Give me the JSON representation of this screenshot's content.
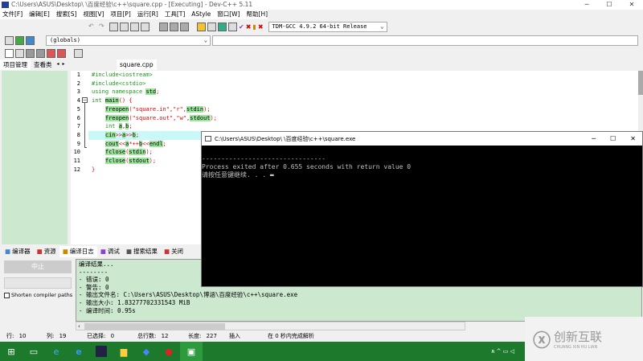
{
  "window": {
    "title": "C:\\Users\\ASUS\\Desktop\\        \\百度经验\\c++\\square.cpp - [Executing] - Dev-C++ 5.11",
    "min": "─",
    "max": "☐",
    "close": "✕"
  },
  "menu": [
    "文件[F]",
    "编辑[E]",
    "搜索[S]",
    "视图[V]",
    "项目[P]",
    "运行[R]",
    "工具[T]",
    "AStyle",
    "窗口[W]",
    "帮助[H]"
  ],
  "toolbar": {
    "compiler_select": "TDM-GCC 4.9.2 64-bit Release",
    "scope_select": "(globals)"
  },
  "left_tabs": [
    "项目管理",
    "查看类"
  ],
  "editor": {
    "file_tab": "square.cpp",
    "current_line": 10,
    "lines": [
      [
        [
          "t",
          "#include<iostream>",
          "grn"
        ]
      ],
      [
        [
          "t",
          "#include<cstdio>",
          "grn"
        ]
      ],
      [
        [
          "t",
          "using namespace ",
          "grn"
        ],
        [
          "t",
          "std",
          "hl"
        ],
        [
          "t",
          ";",
          "red"
        ]
      ],
      [
        [
          "t",
          "int ",
          "grn"
        ],
        [
          "t",
          "main",
          "hl"
        ],
        [
          "t",
          "() {",
          "red"
        ]
      ],
      [
        [
          "t",
          "    "
        ],
        [
          "t",
          "freopen",
          "hl"
        ],
        [
          "t",
          "(\"square.in\",\"r\",",
          "red"
        ],
        [
          "t",
          "stdin",
          "hl"
        ],
        [
          "t",
          ");",
          "red"
        ]
      ],
      [
        [
          "t",
          "    "
        ],
        [
          "t",
          "freopen",
          "hl"
        ],
        [
          "t",
          "(\"square.out\",\"w\",",
          "red"
        ],
        [
          "t",
          "stdout",
          "hl"
        ],
        [
          "t",
          ");",
          "red"
        ]
      ],
      [
        [
          "t",
          "    int ",
          "grn"
        ],
        [
          "t",
          "a",
          "hl"
        ],
        [
          "t",
          ",",
          "red"
        ],
        [
          "t",
          "b",
          "hl"
        ],
        [
          "t",
          ";",
          "red"
        ]
      ],
      [
        [
          "t",
          "    "
        ],
        [
          "t",
          "cin",
          "hl"
        ],
        [
          "t",
          ">>",
          "red"
        ],
        [
          "t",
          "a",
          "hl"
        ],
        [
          "t",
          ">>",
          "red"
        ],
        [
          "t",
          "b",
          "hl"
        ],
        [
          "t",
          ";",
          "red"
        ]
      ],
      [
        [
          "t",
          "    "
        ],
        [
          "t",
          "cout",
          "hl"
        ],
        [
          "t",
          "<<",
          "red"
        ],
        [
          "t",
          "a",
          "hl"
        ],
        [
          "t",
          "*++",
          "red"
        ],
        [
          "t",
          "b",
          "hl"
        ],
        [
          "t",
          "<<",
          "red"
        ],
        [
          "t",
          "endl",
          "hl"
        ],
        [
          "t",
          ";",
          "red"
        ]
      ],
      [
        [
          "t",
          "    "
        ],
        [
          "t",
          "fclose",
          "hl"
        ],
        [
          "t",
          "(",
          "red"
        ],
        [
          "t",
          "stdin",
          "hl"
        ],
        [
          "t",
          ");",
          "red"
        ]
      ],
      [
        [
          "t",
          "    "
        ],
        [
          "t",
          "fclose",
          "hl"
        ],
        [
          "t",
          "(",
          "red"
        ],
        [
          "t",
          "stdout",
          "hl"
        ],
        [
          "t",
          ");",
          "red"
        ]
      ],
      [
        [
          "t",
          "}",
          "red"
        ]
      ]
    ]
  },
  "console": {
    "title": "C:\\Users\\ASUS\\Desktop\\        \\百度经验\\c++\\square.exe",
    "lines": [
      "",
      "--------------------------------",
      "Process exited after 0.655 seconds with return value 0",
      "请按任意键继续. . . ▬"
    ]
  },
  "bottom_tabs": [
    "编译器",
    "资源",
    "编译日志",
    "调试",
    "搜索结果",
    "关闭"
  ],
  "abort_button": "中止",
  "shorten_paths": "Shorten compiler paths",
  "log": [
    "编译结果...",
    "--------",
    "- 错误: 0",
    "- 警告: 0",
    "- 输出文件名: C:\\Users\\ASUS\\Desktop\\博涵\\百度经验\\c++\\square.exe",
    "- 输出大小: 1.83277702331543 MiB",
    "- 编译时间: 0.95s"
  ],
  "status": {
    "row_label": "行:",
    "row": "10",
    "col_label": "列:",
    "col": "19",
    "sel_label": "已选择:",
    "sel": "0",
    "total_label": "总行数:",
    "total": "12",
    "len_label": "长度:",
    "len": "227",
    "mode": "插入",
    "parse": "在 0 秒内完成解析"
  },
  "watermark": {
    "cn": "创新互联",
    "en": "CHUANG XIN HU LIAN"
  },
  "colors": {
    "panel_green": "#cce8cf",
    "taskbar": "#1d7a2c",
    "current_line": "#c8f8f8"
  }
}
